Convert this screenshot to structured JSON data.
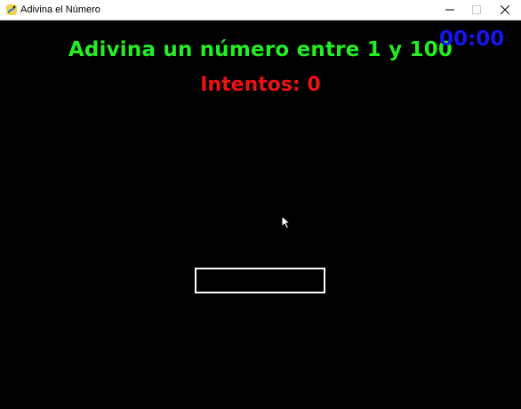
{
  "window": {
    "title": "Adivina el Número",
    "icon": "pygame-snake-icon",
    "controls": {
      "minimize_icon": "minimize-icon",
      "maximize_icon": "maximize-icon",
      "close_icon": "close-icon"
    }
  },
  "game": {
    "headline": "Adivina un número entre 1 y 100",
    "attempts": "Intentos: 0",
    "timer": "00:00",
    "guess_value": "",
    "colors": {
      "background": "#000000",
      "headline": "#22ee22",
      "attempts": "#ee1111",
      "timer": "#1515ee",
      "input_border": "#ffffff"
    }
  }
}
